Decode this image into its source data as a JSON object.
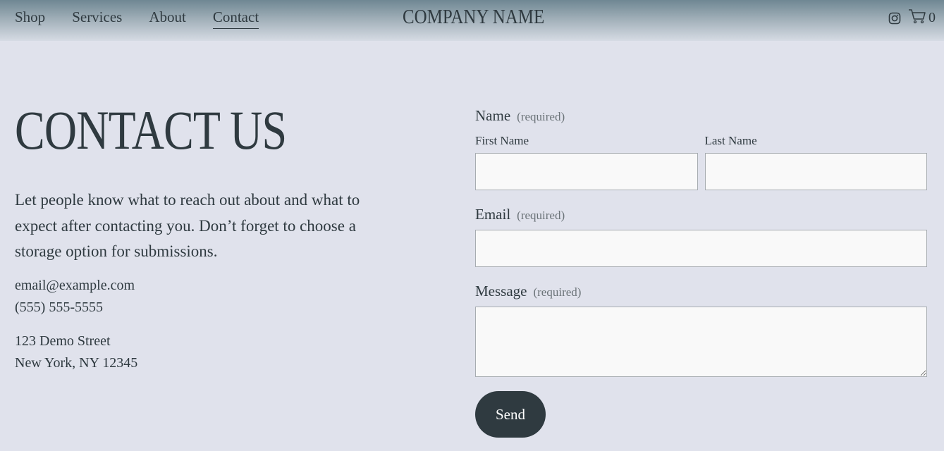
{
  "header": {
    "nav": [
      "Shop",
      "Services",
      "About",
      "Contact"
    ],
    "active_nav": "Contact",
    "logo": "COMPANY NAME",
    "cart_count": "0",
    "icons": [
      "instagram-icon",
      "cart-icon"
    ]
  },
  "main": {
    "title": "CONTACT US",
    "intro": "Let people know what to reach out about and what to expect after contacting you. Don’t forget to choose a storage option for submissions.",
    "email": "email@example.com",
    "phone": "(555) 555-5555",
    "address_line1": "123 Demo Street",
    "address_line2": "New York, NY 12345"
  },
  "form": {
    "name_label": "Name",
    "required_text": "(required)",
    "first_name_label": "First Name",
    "last_name_label": "Last Name",
    "first_name_value": "",
    "last_name_value": "",
    "email_label": "Email",
    "email_value": "",
    "message_label": "Message",
    "message_value": "",
    "send_label": "Send"
  },
  "colors": {
    "background": "#e0e2ec",
    "text": "#2f3a40",
    "button": "#2f3a40",
    "input_bg": "#f9f9f9"
  }
}
